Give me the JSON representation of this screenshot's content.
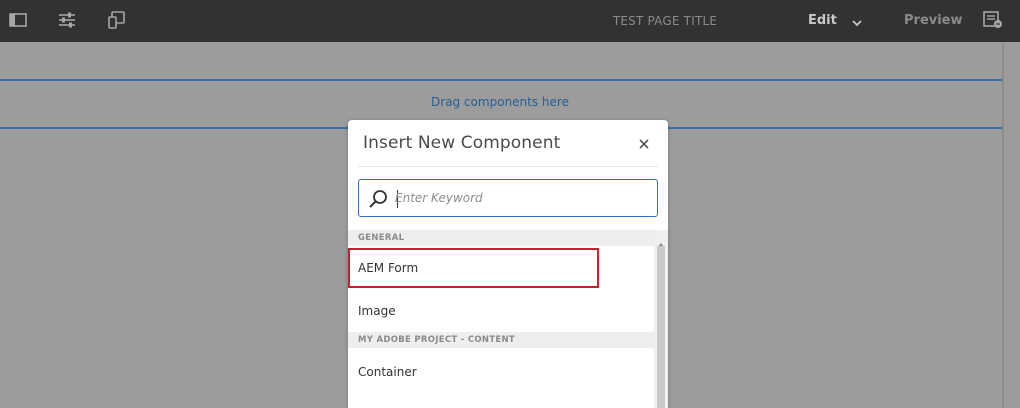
{
  "toolbar": {
    "page_title": "TEST PAGE TITLE",
    "edit_label": "Edit",
    "preview_label": "Preview",
    "icons": [
      "side-panel-icon",
      "properties-icon",
      "emulator-icon",
      "page-info-icon"
    ]
  },
  "page": {
    "dropzone_text": "Drag components here"
  },
  "dialog": {
    "title": "Insert New Component",
    "search_placeholder": "Enter Keyword",
    "groups": [
      {
        "name": "GENERAL",
        "items": [
          "AEM Form",
          "Image"
        ]
      },
      {
        "name": "MY ADOBE PROJECT - CONTENT",
        "items": [
          "Container"
        ]
      }
    ]
  },
  "colors": {
    "toolbar_bg": "#323232",
    "page_bg": "#9c9c9c",
    "dropzone_line": "#3a6e9e",
    "search_border": "#326ec8",
    "highlight": "#c8202f"
  }
}
